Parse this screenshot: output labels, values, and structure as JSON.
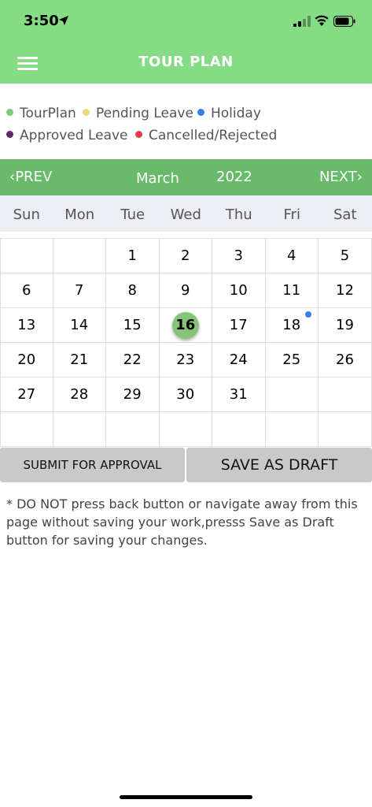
{
  "status_bar": {
    "time": "3:50"
  },
  "header": {
    "title": "TOUR PLAN"
  },
  "legend": [
    {
      "label": "TourPlan",
      "color": "#7fc97f"
    },
    {
      "label": "Pending Leave",
      "color": "#f0d57a"
    },
    {
      "label": "Holiday",
      "color": "#3b7de8"
    },
    {
      "label": "Approved Leave",
      "color": "#5a2a6b"
    },
    {
      "label": "Cancelled/Rejected",
      "color": "#e23b4e"
    }
  ],
  "calendar": {
    "prev": "PREV",
    "next": "NEXT",
    "month": "March",
    "year": "2022",
    "weekdays": [
      "Sun",
      "Mon",
      "Tue",
      "Wed",
      "Thu",
      "Fri",
      "Sat"
    ],
    "weeks": [
      [
        "",
        "",
        "1",
        "2",
        "3",
        "4",
        "5"
      ],
      [
        "6",
        "7",
        "8",
        "9",
        "10",
        "11",
        "12"
      ],
      [
        "13",
        "14",
        "15",
        "16",
        "17",
        "18",
        "19"
      ],
      [
        "20",
        "21",
        "22",
        "23",
        "24",
        "25",
        "26"
      ],
      [
        "27",
        "28",
        "29",
        "30",
        "31",
        "",
        ""
      ],
      [
        "",
        "",
        "",
        "",
        "",
        "",
        ""
      ]
    ],
    "selected_day": "16",
    "holiday_day": "18"
  },
  "actions": {
    "submit": "SUBMIT FOR APPROVAL",
    "draft": "SAVE AS DRAFT"
  },
  "note": "* DO NOT press back button or navigate away from this page without saving your work,presss Save as Draft button for saving your changes."
}
